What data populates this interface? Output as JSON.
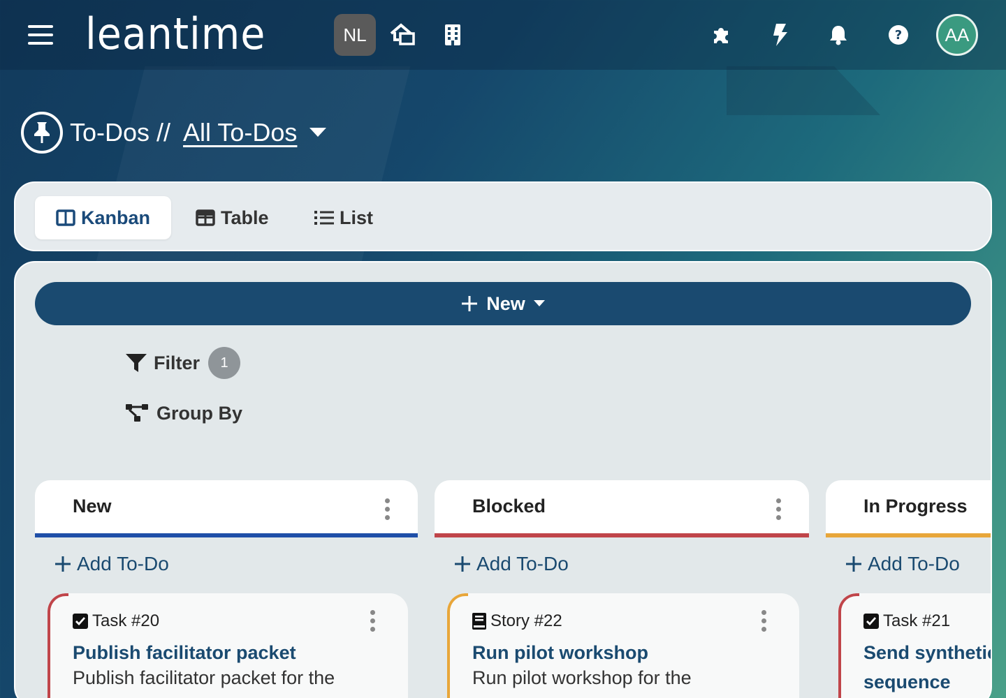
{
  "header": {
    "logo_text": "leantime",
    "project_badge": "NL",
    "avatar_initials": "AA"
  },
  "page": {
    "title": "To-Dos //",
    "view_name": "All To-Dos"
  },
  "views": {
    "kanban": "Kanban",
    "table": "Table",
    "list": "List"
  },
  "toolbar": {
    "new_label": "New",
    "filter_label": "Filter",
    "filter_count": "1",
    "group_by_label": "Group By"
  },
  "columns": [
    {
      "title": "New",
      "color": "#1f4fa8",
      "add_label": "Add To-Do"
    },
    {
      "title": "Blocked",
      "color": "#c0454a",
      "add_label": "Add To-Do"
    },
    {
      "title": "In Progress",
      "color": "#e8a63a",
      "add_label": "Add To-Do"
    }
  ],
  "cards": [
    {
      "type": "Task #20",
      "title": "Publish facilitator packet",
      "desc": "Publish facilitator packet for the",
      "accent": "#c0454a"
    },
    {
      "type": "Story #22",
      "title": "Run pilot workshop",
      "desc": "Run pilot workshop for the",
      "accent": "#e8a63a"
    },
    {
      "type": "Task #21",
      "title": "Send synthetic",
      "title2": "sequence",
      "accent": "#c0454a"
    }
  ]
}
